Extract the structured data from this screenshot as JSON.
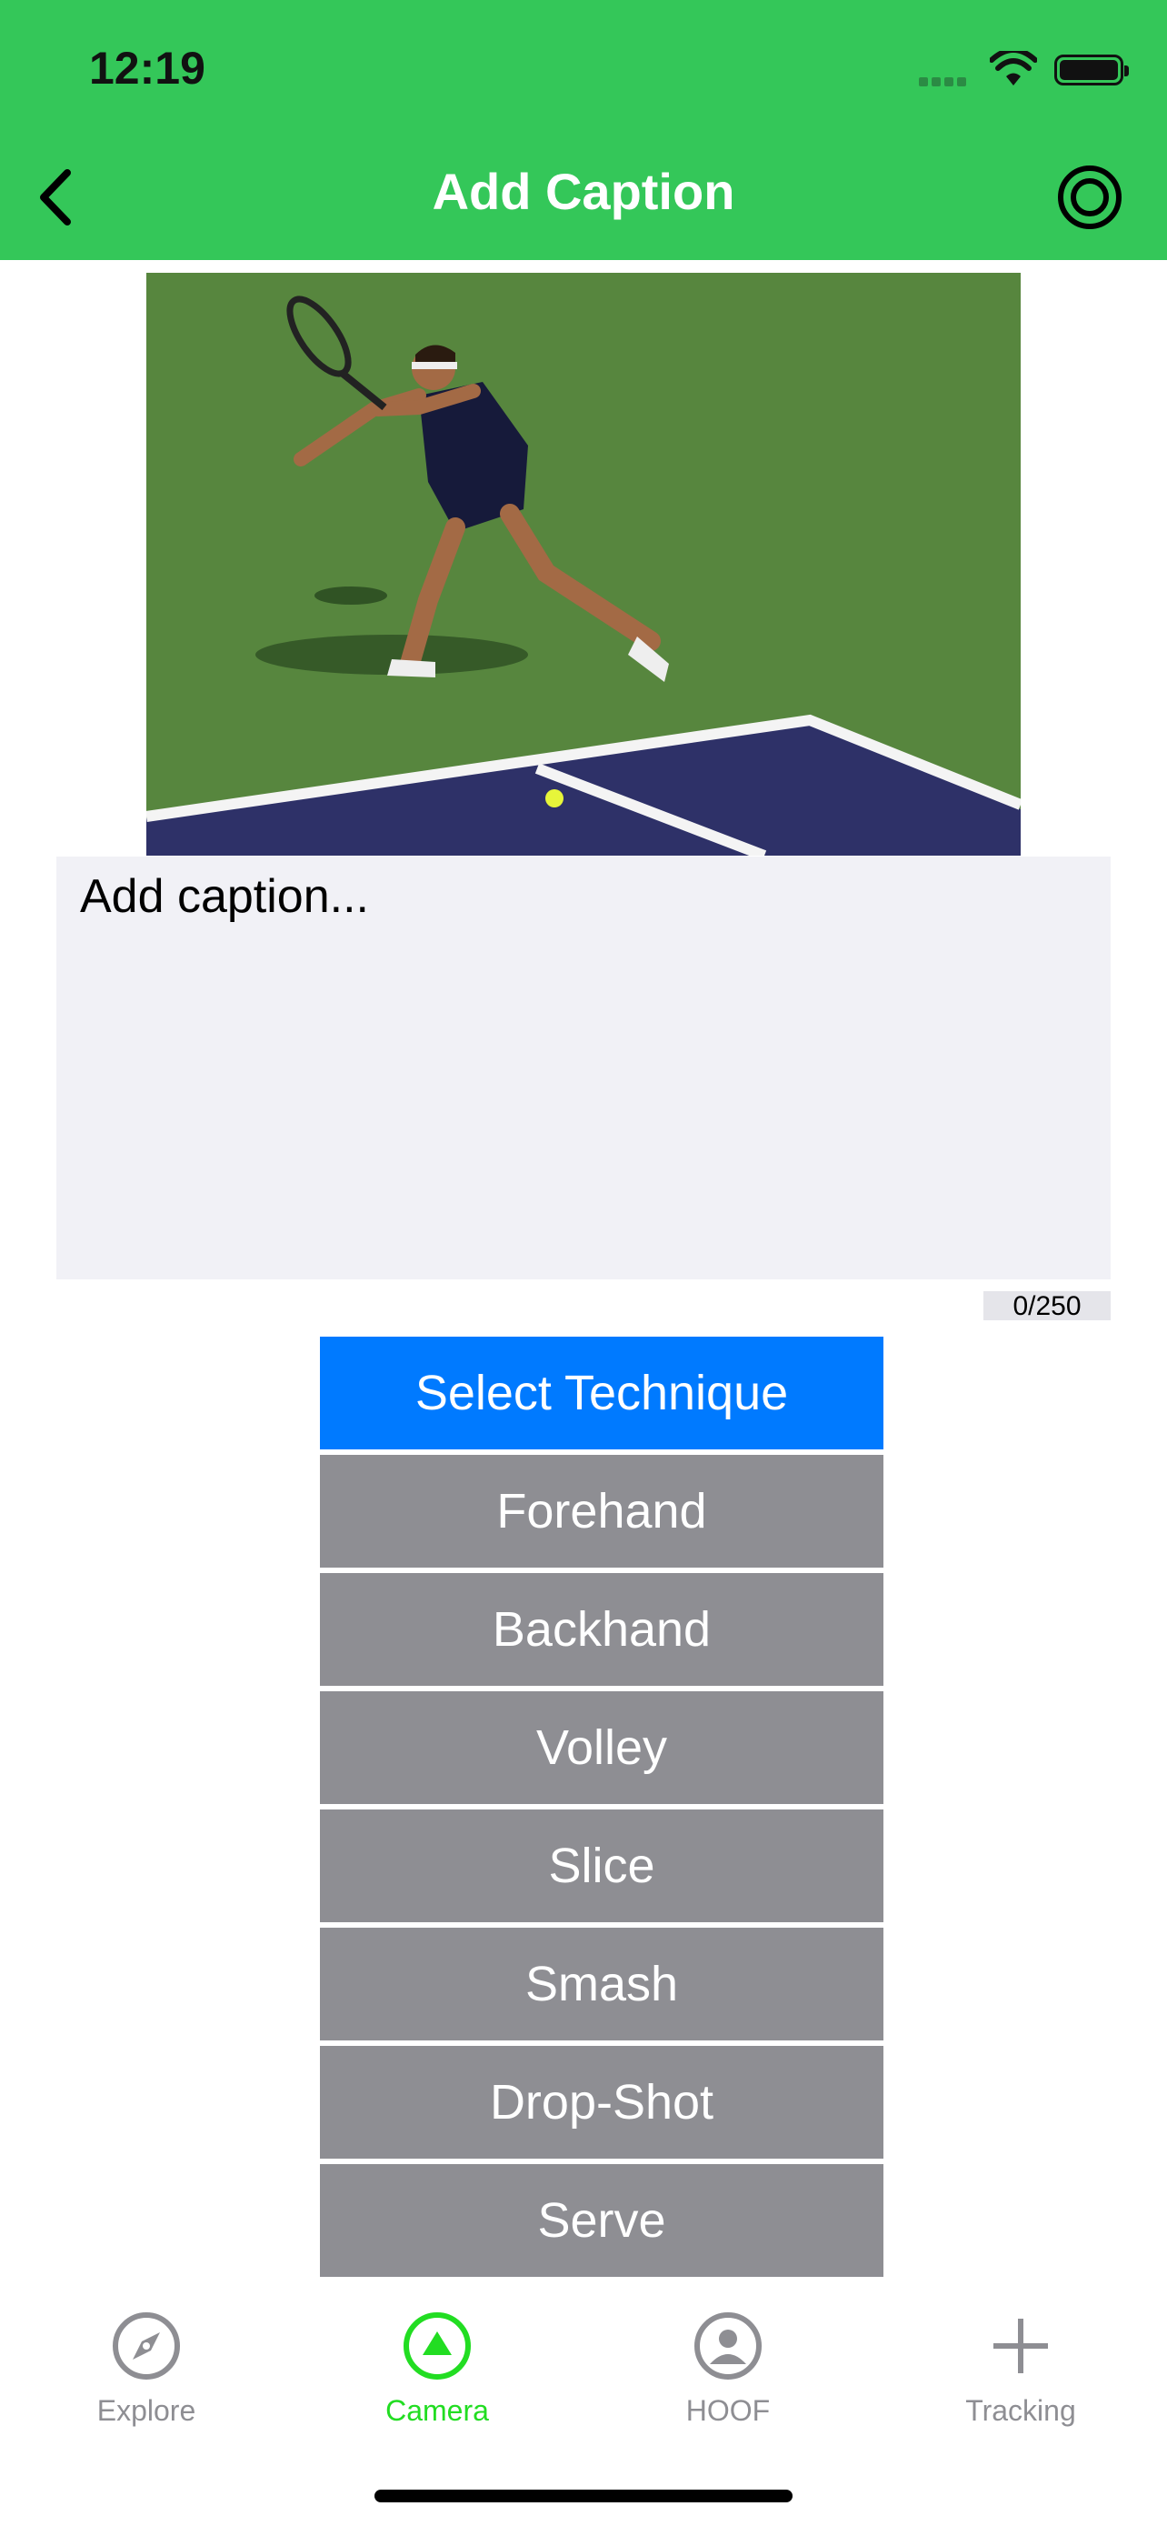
{
  "status_bar": {
    "time": "12:19"
  },
  "header": {
    "title": "Add Caption",
    "back_icon": "chevron-left-icon",
    "settings_icon": "target-icon",
    "color": "#34c759"
  },
  "caption": {
    "placeholder": "Add caption...",
    "counter": "0/250"
  },
  "techniques": {
    "select_label": "Select Technique",
    "items": [
      "Forehand",
      "Backhand",
      "Volley",
      "Slice",
      "Smash",
      "Drop-Shot",
      "Serve"
    ]
  },
  "tabbar": {
    "tabs": [
      {
        "label": "Explore",
        "icon": "compass-icon",
        "active": false
      },
      {
        "label": "Camera",
        "icon": "camera-triangle-icon",
        "active": true
      },
      {
        "label": "HOOF",
        "icon": "person-circle-icon",
        "active": false
      },
      {
        "label": "Tracking",
        "icon": "plus-icon",
        "active": false
      }
    ]
  },
  "colors": {
    "primary": "#007aff",
    "button_gray": "#8e8e93",
    "active_tab": "#22dd22"
  }
}
